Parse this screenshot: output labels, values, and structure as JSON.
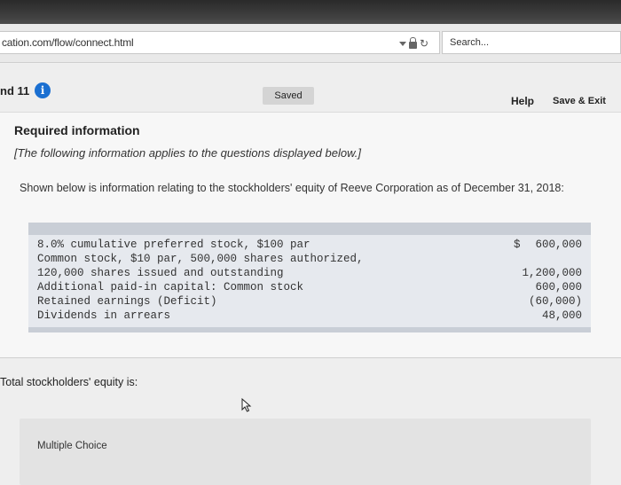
{
  "browser": {
    "url": "cation.com/flow/connect.html",
    "search_placeholder": "Search..."
  },
  "header": {
    "question_label": "nd 11",
    "info_glyph": "i",
    "saved_label": "Saved",
    "help_label": "Help",
    "save_exit_label": "Save & Exit"
  },
  "card": {
    "title": "Required information",
    "note": "[The following information applies to the questions displayed below.]",
    "intro": "Shown below is information relating to the stockholders' equity of Reeve Corporation as of December 31, 2018:",
    "rows": [
      {
        "label": "8.0% cumulative preferred stock, $100 par",
        "dollar": "$",
        "value": "600,000"
      },
      {
        "label": "Common stock, $10 par, 500,000 shares authorized,",
        "dollar": "",
        "value": ""
      },
      {
        "label": "120,000 shares issued and outstanding",
        "dollar": "",
        "value": "1,200,000"
      },
      {
        "label": "Additional paid-in capital: Common stock",
        "dollar": "",
        "value": "600,000"
      },
      {
        "label": "Retained earnings (Deficit)",
        "dollar": "",
        "value": "(60,000)"
      },
      {
        "label": "Dividends in arrears",
        "dollar": "",
        "value": "48,000"
      }
    ]
  },
  "question": {
    "text": "Total stockholders' equity is:",
    "choice_header": "Multiple Choice"
  }
}
